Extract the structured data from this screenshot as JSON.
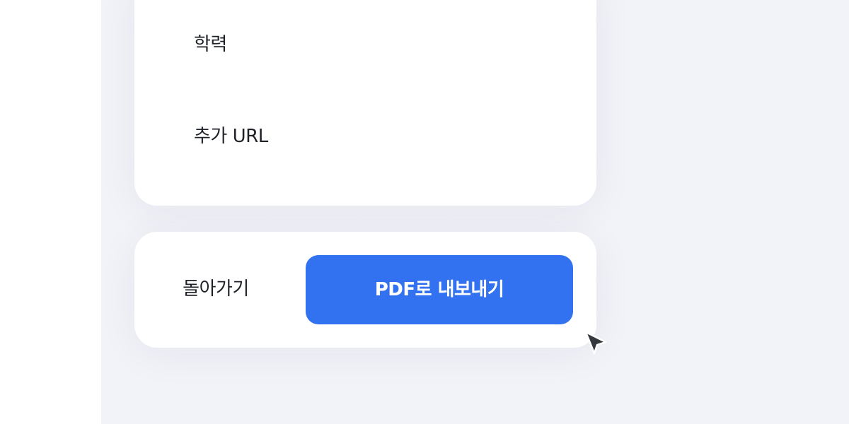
{
  "fields": {
    "education_label": "학력",
    "extra_url_label": "추가 URL"
  },
  "actions": {
    "back_label": "돌아가기",
    "export_pdf_label": "PDF로 내보내기"
  },
  "colors": {
    "primary": "#3272f0",
    "background": "#f2f3f8",
    "card": "#ffffff",
    "text": "#1f2329"
  },
  "icons": {
    "cursor": "mouse-pointer-icon"
  }
}
